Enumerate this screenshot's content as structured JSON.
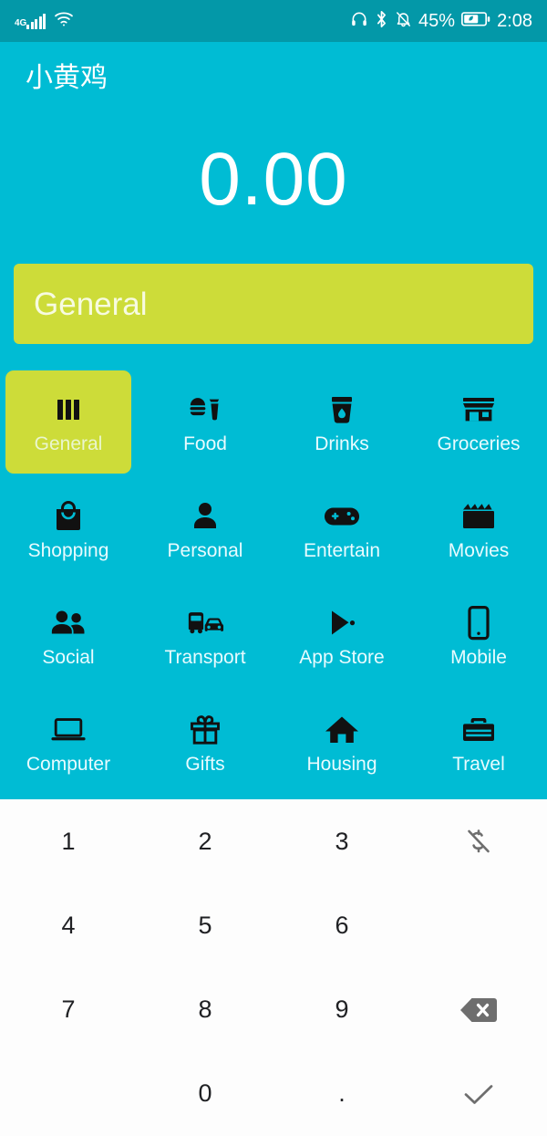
{
  "status_bar": {
    "network_label": "4G",
    "signal_icon": "signal-bars-icon",
    "wifi_icon": "wifi-icon",
    "headphone_icon": "headphone-icon",
    "bluetooth_icon": "bluetooth-icon",
    "silent_icon": "bell-off-icon",
    "battery_percent": "45%",
    "battery_icon": "battery-power-saving-icon",
    "time": "2:08"
  },
  "header": {
    "app_title": "小黄鸡"
  },
  "amount": {
    "value": "0.00"
  },
  "note_field": {
    "value": "General",
    "placeholder": "General"
  },
  "categories": [
    {
      "label": "General",
      "icon": "view-columns-icon",
      "selected": true
    },
    {
      "label": "Food",
      "icon": "fastfood-icon",
      "selected": false
    },
    {
      "label": "Drinks",
      "icon": "drink-cup-icon",
      "selected": false
    },
    {
      "label": "Groceries",
      "icon": "store-icon",
      "selected": false
    },
    {
      "label": "Shopping",
      "icon": "shopping-bag-icon",
      "selected": false
    },
    {
      "label": "Personal",
      "icon": "person-icon",
      "selected": false
    },
    {
      "label": "Entertain",
      "icon": "gamepad-icon",
      "selected": false
    },
    {
      "label": "Movies",
      "icon": "clapperboard-icon",
      "selected": false
    },
    {
      "label": "Social",
      "icon": "people-icon",
      "selected": false
    },
    {
      "label": "Transport",
      "icon": "bus-car-icon",
      "selected": false
    },
    {
      "label": "App Store",
      "icon": "play-store-icon",
      "selected": false
    },
    {
      "label": "Mobile",
      "icon": "smartphone-icon",
      "selected": false
    },
    {
      "label": "Computer",
      "icon": "laptop-icon",
      "selected": false
    },
    {
      "label": "Gifts",
      "icon": "gift-icon",
      "selected": false
    },
    {
      "label": "Housing",
      "icon": "home-icon",
      "selected": false
    },
    {
      "label": "Travel",
      "icon": "briefcase-icon",
      "selected": false
    }
  ],
  "keypad": {
    "keys": [
      {
        "label": "1",
        "type": "digit"
      },
      {
        "label": "2",
        "type": "digit"
      },
      {
        "label": "3",
        "type": "digit"
      },
      {
        "label": "",
        "type": "icon",
        "icon": "money-off-icon"
      },
      {
        "label": "4",
        "type": "digit"
      },
      {
        "label": "5",
        "type": "digit"
      },
      {
        "label": "6",
        "type": "digit"
      },
      {
        "label": "",
        "type": "blank"
      },
      {
        "label": "7",
        "type": "digit"
      },
      {
        "label": "8",
        "type": "digit"
      },
      {
        "label": "9",
        "type": "digit"
      },
      {
        "label": "",
        "type": "icon",
        "icon": "backspace-icon"
      },
      {
        "label": "",
        "type": "blank"
      },
      {
        "label": "0",
        "type": "digit"
      },
      {
        "label": ".",
        "type": "decimal"
      },
      {
        "label": "",
        "type": "icon",
        "icon": "check-icon"
      }
    ]
  },
  "colors": {
    "accent_cyan": "#00bcd4",
    "status_bar_teal": "#0398a8",
    "lime": "#cddc39",
    "keypad_background": "#fdfdfd",
    "key_text": "#202124",
    "key_icon_gray": "#6e6e6e"
  }
}
